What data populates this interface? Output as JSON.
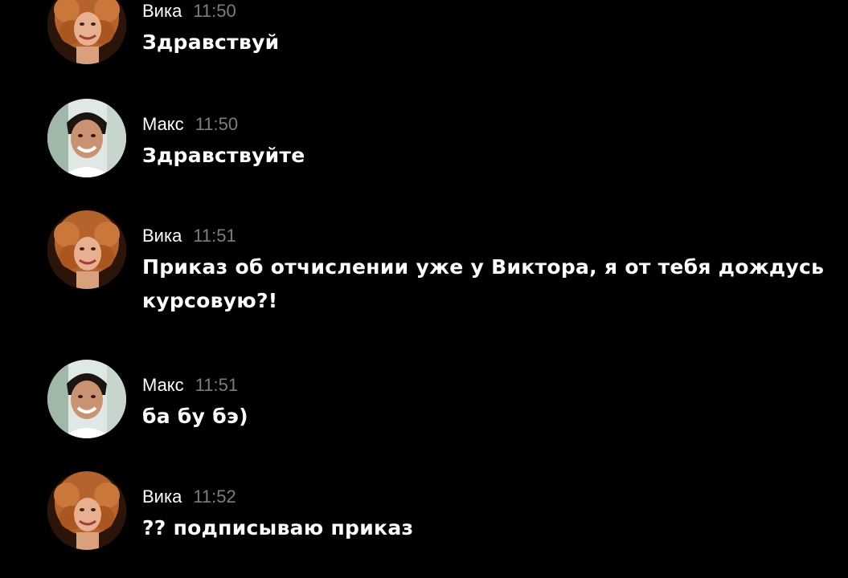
{
  "messages": [
    {
      "author": "Вика",
      "time": "11:50",
      "text": "Здравствуй",
      "avatar": "female-avatar"
    },
    {
      "author": "Макс",
      "time": "11:50",
      "text": "Здравствуйте",
      "avatar": "male-avatar"
    },
    {
      "author": "Вика",
      "time": "11:51",
      "text": "Приказ об отчислении уже у Виктора, я от тебя дождусь курсовую?!",
      "avatar": "female-avatar"
    },
    {
      "author": "Макс",
      "time": "11:51",
      "text": "ба бу бэ)",
      "avatar": "male-avatar"
    },
    {
      "author": "Вика",
      "time": "11:52",
      "text": "?? подписываю приказ",
      "avatar": "female-avatar"
    }
  ],
  "colors": {
    "background": "#000000",
    "text": "#ffffff",
    "timestamp": "#7d7d7d"
  }
}
